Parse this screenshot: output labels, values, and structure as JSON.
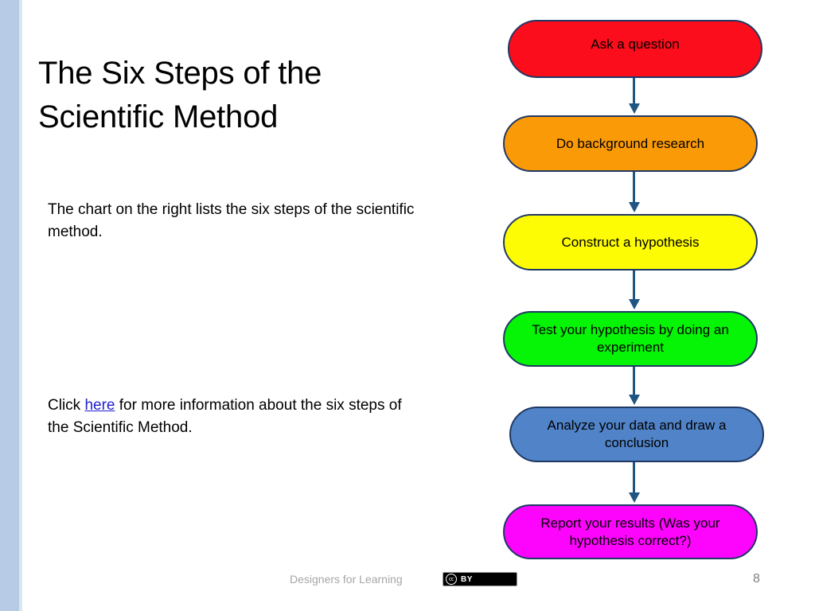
{
  "slide": {
    "title": "The Six Steps of the Scientific Method",
    "accent_band_color": "#b8cbe6",
    "background_color": "#ffffff"
  },
  "body": {
    "paragraph_1": "The chart on the right lists the six steps of the scientific method.",
    "paragraph_2_before": "Click ",
    "paragraph_2_link": "here",
    "paragraph_2_after": " for more information about the six steps of the Scientific Method."
  },
  "chart_data": {
    "type": "diagram",
    "diagram_type": "flowchart",
    "title": "The Six Steps of the Scientific Method",
    "orientation": "vertical",
    "connector_color": "#1f5582",
    "node_border_color": "#1f3864",
    "node_shape": "stadium",
    "nodes": [
      {
        "step": 1,
        "label": "Ask a question",
        "color": "#fc0d1b"
      },
      {
        "step": 2,
        "label": "Do background research",
        "color": "#fb9a07"
      },
      {
        "step": 3,
        "label": "Construct a hypothesis",
        "color": "#fdfc04"
      },
      {
        "step": 4,
        "label": "Test your hypothesis by doing an experiment",
        "color": "#06f406"
      },
      {
        "step": 5,
        "label": "Analyze your data and draw a conclusion",
        "color": "#5083c8"
      },
      {
        "step": 6,
        "label": "Report your results (Was your hypothesis correct?)",
        "color": "#fd04fd"
      }
    ],
    "edges": [
      {
        "from": 1,
        "to": 2
      },
      {
        "from": 2,
        "to": 3
      },
      {
        "from": 3,
        "to": 4
      },
      {
        "from": 4,
        "to": 5
      },
      {
        "from": 5,
        "to": 6
      }
    ]
  },
  "footer": {
    "attribution": "Designers for Learning",
    "license_cc": "cc",
    "license_by": "BY",
    "page_number": "8"
  }
}
